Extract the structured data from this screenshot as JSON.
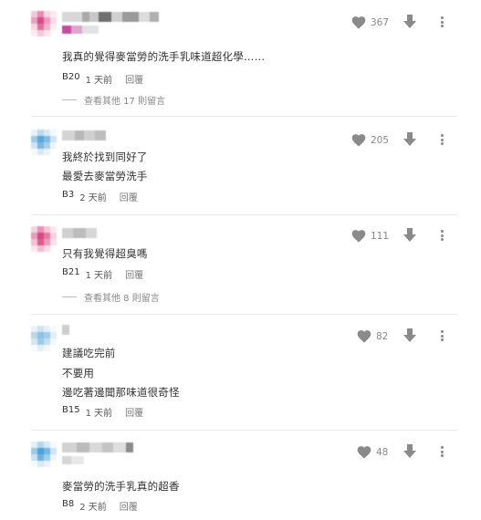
{
  "comments": [
    {
      "lines": [
        "我真的覺得麥當勞的洗手乳味道超化學……"
      ],
      "floor": "B20",
      "time": "1 天前",
      "reply_label": "回覆",
      "likes": "367",
      "more_replies": "查看其他 17 則留言"
    },
    {
      "lines": [
        "我終於找到同好了",
        "最愛去麥當勞洗手"
      ],
      "floor": "B3",
      "time": "2 天前",
      "reply_label": "回覆",
      "likes": "205",
      "more_replies": null
    },
    {
      "lines": [
        "只有我覺得超臭嗎"
      ],
      "floor": "B21",
      "time": "1 天前",
      "reply_label": "回覆",
      "likes": "111",
      "more_replies": "查看其他 8 則留言"
    },
    {
      "lines": [
        "建議吃完前",
        "不要用",
        "邊吃著邊聞那味道很奇怪"
      ],
      "floor": "B15",
      "time": "1 天前",
      "reply_label": "回覆",
      "likes": "82",
      "more_replies": null
    },
    {
      "lines": [
        "麥當勞的洗手乳真的超香"
      ],
      "floor": "B8",
      "time": "2 天前",
      "reply_label": "回覆",
      "likes": "48",
      "more_replies": null
    }
  ],
  "icons": {
    "like": "heart-icon",
    "dislike": "arrow-down-icon",
    "menu": "more-vertical-icon"
  },
  "colors": {
    "icon_gray": "#8a8a8a",
    "text": "#333333",
    "muted": "#888888"
  }
}
